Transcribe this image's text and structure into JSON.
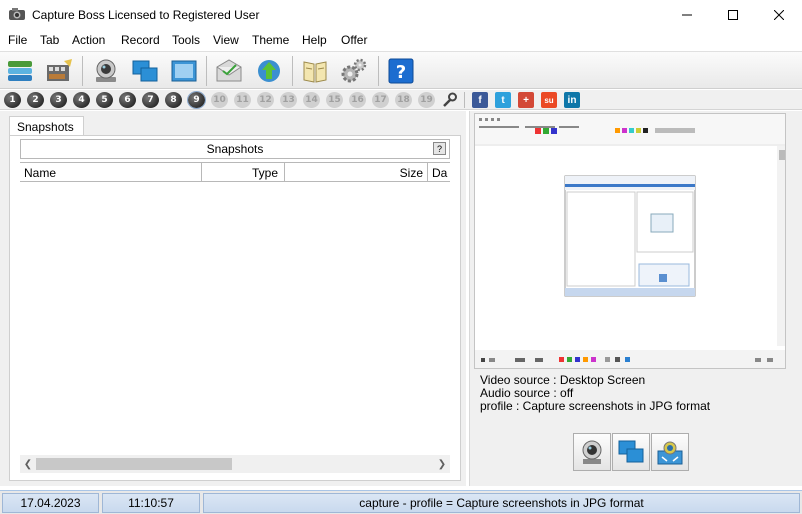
{
  "window": {
    "title": "Capture Boss Licensed to Registered User",
    "minimize": "—",
    "maximize": "☐",
    "close": "✕"
  },
  "menu": [
    "File",
    "Tab",
    "Action",
    "Record",
    "Tools",
    "View",
    "Theme",
    "Help",
    "Offer"
  ],
  "toolbar": {
    "icons": [
      "stack-icon",
      "film-icon",
      "webcam-icon",
      "windows-icon",
      "region-icon",
      "mail-icon",
      "upload-icon",
      "book-icon",
      "gears-icon",
      "help-icon"
    ]
  },
  "numbers": {
    "active": [
      "1",
      "2",
      "3",
      "4",
      "5",
      "6",
      "7",
      "8",
      "9"
    ],
    "inactive": [
      "10",
      "11",
      "12",
      "13",
      "14",
      "15",
      "16",
      "17",
      "18",
      "19"
    ]
  },
  "social": [
    {
      "label": "f",
      "color": "#3b5998"
    },
    {
      "label": "t",
      "color": "#2ea1dc"
    },
    {
      "label": "+",
      "color": "#d34836"
    },
    {
      "label": "su",
      "color": "#eb4924"
    },
    {
      "label": "in",
      "color": "#0e76a8"
    }
  ],
  "left": {
    "tab_label": "Snapshots",
    "header": "Snapshots",
    "help": "?",
    "columns": [
      "Name",
      "Type",
      "Size",
      "Da"
    ]
  },
  "right": {
    "video_source": "Video source : Desktop Screen",
    "audio_source": "Audio source : off",
    "profile": "profile : Capture screenshots in JPG format"
  },
  "status": {
    "date": "17.04.2023",
    "time": "11:10:57",
    "message": "capture - profile =  Capture screenshots in JPG format"
  }
}
